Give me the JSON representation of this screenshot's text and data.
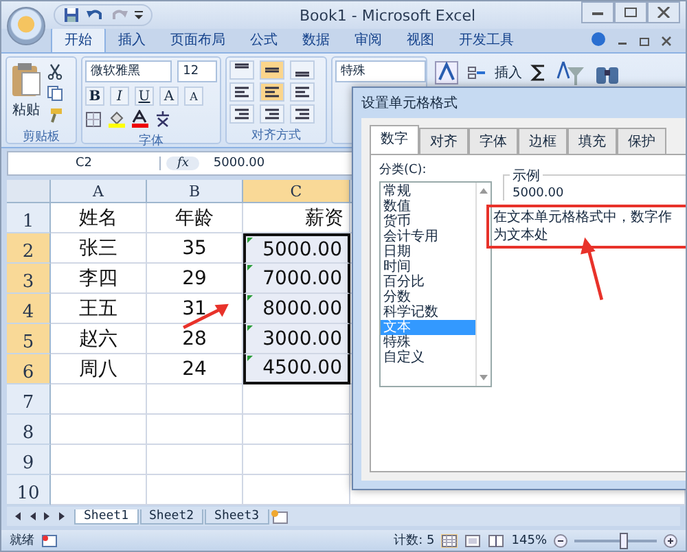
{
  "window": {
    "title": "Book1 - Microsoft Excel"
  },
  "ribbon_tabs": [
    {
      "label": "开始",
      "selected": true
    },
    {
      "label": "插入",
      "selected": false
    },
    {
      "label": "页面布局",
      "selected": false
    },
    {
      "label": "公式",
      "selected": false
    },
    {
      "label": "数据",
      "selected": false
    },
    {
      "label": "审阅",
      "selected": false
    },
    {
      "label": "视图",
      "selected": false
    },
    {
      "label": "开发工具",
      "selected": false
    }
  ],
  "ribbon": {
    "font_buttons": [
      "B",
      "I",
      "U",
      "A",
      "A"
    ],
    "paste": "粘贴",
    "clipboard_label": "剪贴板",
    "font_name": "微软雅黑",
    "font_size": "12",
    "font_label": "字体",
    "alignment_label": "对齐方式",
    "number_format": "特殊",
    "insert": "插入"
  },
  "formula_bar": {
    "name_box": "C2",
    "function_label": "fx",
    "value": "5000.00"
  },
  "columns": [
    {
      "label": "A",
      "selected": false
    },
    {
      "label": "B",
      "selected": false
    },
    {
      "label": "C",
      "selected": true
    }
  ],
  "rows": [
    {
      "header": "1",
      "selected": false,
      "cells": [
        {
          "text": "姓名",
          "selected": false,
          "flag": false
        },
        {
          "text": "年龄",
          "selected": false,
          "flag": false
        },
        {
          "text": "薪资",
          "selected": false,
          "flag": false
        }
      ]
    },
    {
      "header": "2",
      "selected": true,
      "cells": [
        {
          "text": "张三",
          "selected": false,
          "flag": false
        },
        {
          "text": "35",
          "selected": false,
          "flag": false
        },
        {
          "text": "5000.00",
          "selected": true,
          "flag": true
        }
      ]
    },
    {
      "header": "3",
      "selected": true,
      "cells": [
        {
          "text": "李四",
          "selected": false,
          "flag": false
        },
        {
          "text": "29",
          "selected": false,
          "flag": false
        },
        {
          "text": "7000.00",
          "selected": true,
          "flag": true
        }
      ]
    },
    {
      "header": "4",
      "selected": true,
      "cells": [
        {
          "text": "王五",
          "selected": false,
          "flag": false
        },
        {
          "text": "31",
          "selected": false,
          "flag": false
        },
        {
          "text": "8000.00",
          "selected": true,
          "flag": true
        }
      ]
    },
    {
      "header": "5",
      "selected": true,
      "cells": [
        {
          "text": "赵六",
          "selected": false,
          "flag": false
        },
        {
          "text": "28",
          "selected": false,
          "flag": false
        },
        {
          "text": "3000.00",
          "selected": true,
          "flag": true
        }
      ]
    },
    {
      "header": "6",
      "selected": true,
      "cells": [
        {
          "text": "周八",
          "selected": false,
          "flag": false
        },
        {
          "text": "24",
          "selected": false,
          "flag": false
        },
        {
          "text": "4500.00",
          "selected": true,
          "flag": true
        }
      ]
    },
    {
      "header": "7",
      "selected": false
    },
    {
      "header": "8",
      "selected": false
    },
    {
      "header": "9",
      "selected": false
    },
    {
      "header": "10",
      "selected": false
    }
  ],
  "sheet_tabs": [
    {
      "label": "Sheet1",
      "selected": true
    },
    {
      "label": "Sheet2",
      "selected": false
    },
    {
      "label": "Sheet3",
      "selected": false
    }
  ],
  "status_bar": {
    "ready": "就绪",
    "count": "计数: 5",
    "zoom": "145%",
    "zoom_slider": {
      "level": 0.6
    }
  },
  "dialog": {
    "title": "设置单元格格式",
    "tabs": [
      {
        "label": "数字",
        "selected": true
      },
      {
        "label": "对齐",
        "selected": false
      },
      {
        "label": "字体",
        "selected": false
      },
      {
        "label": "边框",
        "selected": false
      },
      {
        "label": "填充",
        "selected": false
      },
      {
        "label": "保护",
        "selected": false
      }
    ],
    "category_label": "分类(C):",
    "categories": [
      {
        "label": "常规",
        "selected": false
      },
      {
        "label": "数值",
        "selected": false
      },
      {
        "label": "货币",
        "selected": false
      },
      {
        "label": "会计专用",
        "selected": false
      },
      {
        "label": "日期",
        "selected": false
      },
      {
        "label": "时间",
        "selected": false
      },
      {
        "label": "百分比",
        "selected": false
      },
      {
        "label": "分数",
        "selected": false
      },
      {
        "label": "科学记数",
        "selected": false
      },
      {
        "label": "文本",
        "selected": true
      },
      {
        "label": "特殊",
        "selected": false
      },
      {
        "label": "自定义",
        "selected": false
      }
    ],
    "sample_label": "示例",
    "sample": "5000.00",
    "description": "在文本单元格格式中，数字作为文本处"
  }
}
